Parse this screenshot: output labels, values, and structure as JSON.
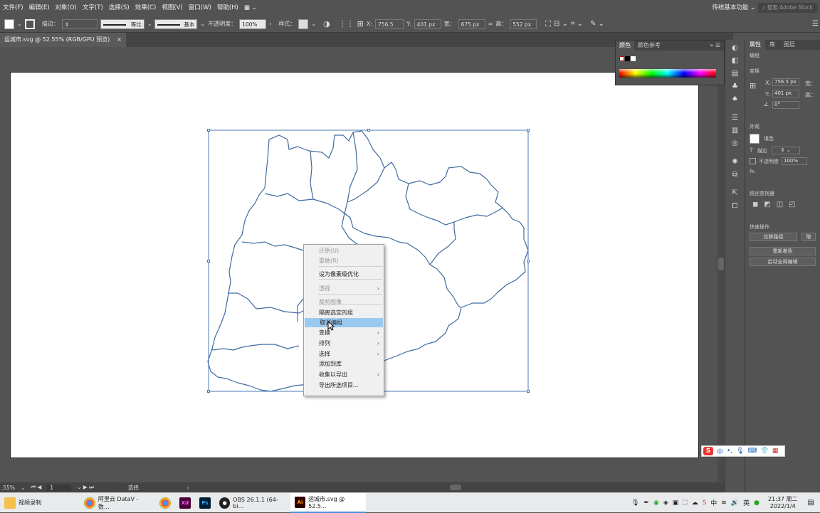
{
  "menu": [
    "文件(F)",
    "编辑(E)",
    "对象(O)",
    "文字(T)",
    "选择(S)",
    "效果(C)",
    "视图(V)",
    "窗口(W)",
    "帮助(H)"
  ],
  "workspace": "传统基本功能",
  "search_placeholder": "搜索 Adobe Stock",
  "control": {
    "stroke_label": "描边：",
    "profile1": "等比",
    "profile2": "基本",
    "opacity_label": "不透明度：",
    "opacity_value": "100%",
    "style_label": "样式：",
    "x_label": "X:",
    "x_value": "756.5 px",
    "y_label": "Y:",
    "y_value": "401 px",
    "w_label": "宽：",
    "w_value": "675 px",
    "h_label": "高：",
    "h_value": "552 px"
  },
  "doc_tab": {
    "title": "运城市.svg @ 52.55% (RGB/GPU 预览)",
    "close": "×"
  },
  "status": {
    "zoom": ".55%",
    "page": "1",
    "tool": "选择"
  },
  "color_panel": {
    "tab1": "颜色",
    "tab2": "颜色参考"
  },
  "right_panel": {
    "tabs": [
      "属性",
      "库",
      "图层"
    ],
    "group_label": "编组",
    "transform_label": "变换",
    "x_label": "X:",
    "x_value": "756.5 px",
    "y_label": "Y:",
    "y_value": "401 px",
    "w_label": "宽：",
    "h_label": "高：",
    "angle_value": "0°",
    "appearance_label": "外观",
    "fill_label": "填色",
    "stroke_label": "描边",
    "opacity_label": "不透明度",
    "opacity_value": "100%",
    "fx": "fx.",
    "pathfinder_label": "路径查找器",
    "quick_label": "快速操作",
    "btn_offset": "位移路径",
    "btn_extra": "取",
    "btn_recolor": "重新着色",
    "btn_global": "启动全局编辑"
  },
  "context_menu": [
    {
      "label": "还原(U)",
      "disabled": true
    },
    {
      "label": "重做(R)",
      "disabled": true
    },
    {
      "label": "设为像素级优化",
      "disabled": false
    },
    {
      "label": "透视",
      "disabled": true,
      "submenu": true
    },
    {
      "label": "隔离选定的组",
      "disabled": false
    },
    {
      "label": "取消编组",
      "disabled": false,
      "highlight": true
    },
    {
      "label": "变换",
      "disabled": false,
      "submenu": true
    },
    {
      "label": "排列",
      "disabled": false,
      "submenu": true
    },
    {
      "label": "选择",
      "disabled": false,
      "submenu": true
    },
    {
      "label": "添加到库",
      "disabled": false
    },
    {
      "label": "收集以导出",
      "disabled": false,
      "submenu": true
    },
    {
      "label": "导出所选项目...",
      "disabled": false
    }
  ],
  "ime": {
    "label": "中"
  },
  "taskbar": {
    "items": [
      "视频录制",
      "阿里云 DataV - 数...",
      "OBS 26.1.1 (64-bi...",
      "运城市.svg @ 52.5..."
    ],
    "time": "21:37 周二",
    "date": "2022/1/4"
  },
  "colors": {
    "map_stroke": "#3f6aa0",
    "selection": "#4a78b4",
    "highlight": "#99c9ef"
  }
}
